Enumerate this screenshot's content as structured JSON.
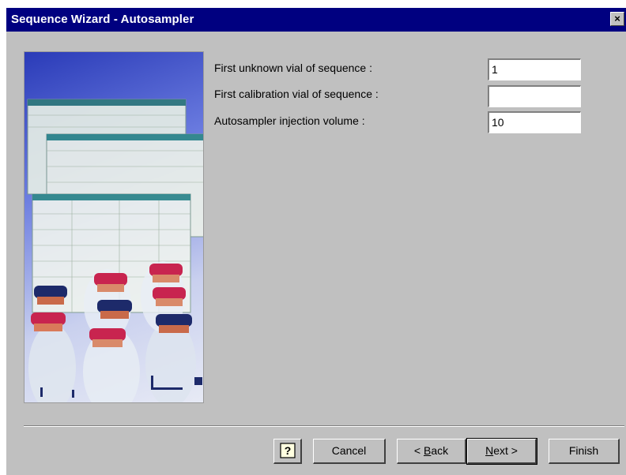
{
  "window": {
    "title": "Sequence Wizard - Autosampler",
    "close_glyph": "×"
  },
  "form": {
    "fields": [
      {
        "label": "First unknown vial of sequence :",
        "value": "1"
      },
      {
        "label": "First calibration vial of sequence :",
        "value": ""
      },
      {
        "label": "Autosampler injection volume :",
        "value": "10"
      }
    ]
  },
  "buttons": {
    "help_icon": "question-mark",
    "cancel": "Cancel",
    "back_prefix": "< ",
    "back_accel": "B",
    "back_rest": "ack",
    "next_accel": "N",
    "next_rest": "ext >",
    "finish": "Finish"
  },
  "colors": {
    "titlebar": "#000080",
    "face": "#c0c0c0"
  }
}
